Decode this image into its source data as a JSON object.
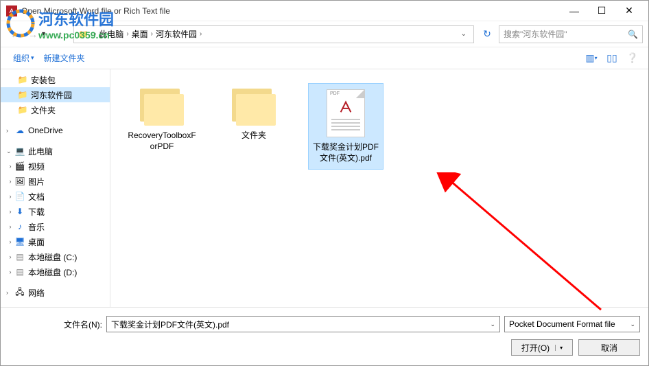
{
  "window": {
    "title": "Open Microsoft Word file or Rich Text file"
  },
  "breadcrumb": {
    "items": [
      "此电脑",
      "桌面",
      "河东软件园"
    ]
  },
  "search": {
    "placeholder": "搜索\"河东软件园\""
  },
  "toolbar": {
    "organize": "组织",
    "new_folder": "新建文件夹"
  },
  "sidebar": {
    "items": [
      {
        "label": "安装包",
        "icon": "folder"
      },
      {
        "label": "河东软件园",
        "icon": "folder",
        "selected": true
      },
      {
        "label": "文件夹",
        "icon": "folder"
      }
    ],
    "onedrive": "OneDrive",
    "this_pc": "此电脑",
    "pc_items": [
      {
        "label": "视频",
        "icon": "video"
      },
      {
        "label": "图片",
        "icon": "image"
      },
      {
        "label": "文档",
        "icon": "docs"
      },
      {
        "label": "下载",
        "icon": "download"
      },
      {
        "label": "音乐",
        "icon": "music"
      },
      {
        "label": "桌面",
        "icon": "desktop"
      },
      {
        "label": "本地磁盘 (C:)",
        "icon": "drive"
      },
      {
        "label": "本地磁盘 (D:)",
        "icon": "drive"
      }
    ],
    "network": "网络"
  },
  "files": [
    {
      "name": "RecoveryToolboxForPDF",
      "type": "folder"
    },
    {
      "name": "文件夹",
      "type": "folder"
    },
    {
      "name": "下载奖金计划PDF文件(英文).pdf",
      "type": "pdf",
      "selected": true
    }
  ],
  "bottom": {
    "filename_label": "文件名(N):",
    "filename_value": "下载奖金计划PDF文件(英文).pdf",
    "filetype": "Pocket Document Format file",
    "open": "打开(O)",
    "cancel": "取消"
  },
  "watermark": {
    "line1": "河东软件园",
    "line2": "www.pc0359.cn"
  }
}
